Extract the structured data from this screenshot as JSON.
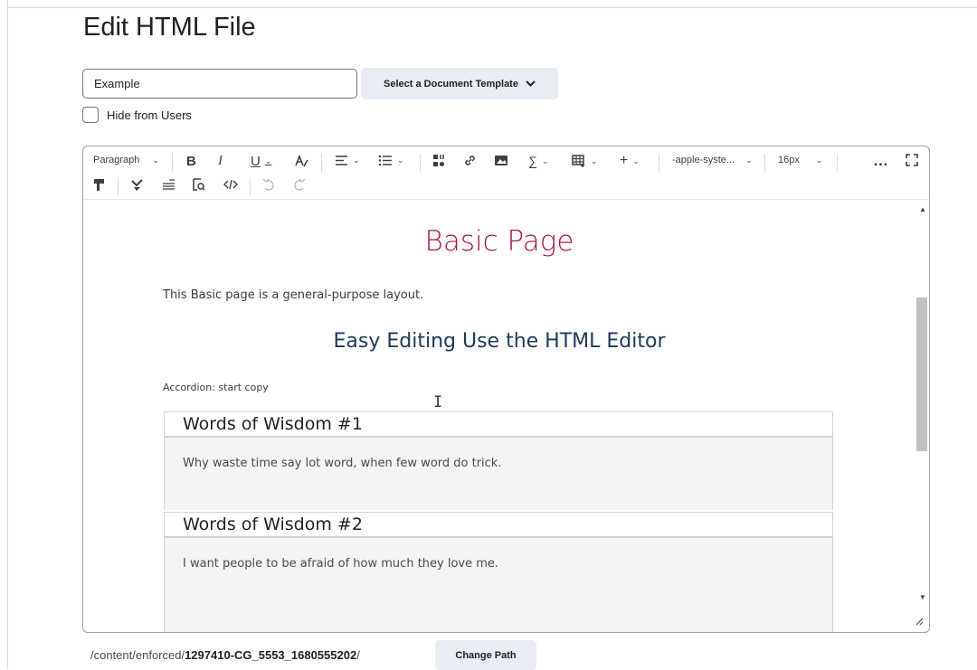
{
  "page": {
    "title": "Edit HTML File"
  },
  "form": {
    "title_value": "Example",
    "template_button_label": "Select a Document Template",
    "hide_from_users_label": "Hide from Users",
    "hide_from_users_checked": false
  },
  "toolbar": {
    "block_format": "Paragraph",
    "bold": "B",
    "italic": "I",
    "underline": "U",
    "insert_plus": "+",
    "font_family": "-apple-syste...",
    "font_size": "16px",
    "more": "…"
  },
  "document": {
    "heading": "Basic Page",
    "intro": "This Basic page is a general-purpose layout.",
    "subheading": "Easy Editing Use the HTML Editor",
    "accordion_note": "Accordion: start copy",
    "accordion": [
      {
        "title": "Words of Wisdom #1",
        "body": "Why waste time say lot word, when few word do trick."
      },
      {
        "title": "Words of Wisdom #2",
        "body": "I want people to be afraid of how much they love me."
      }
    ]
  },
  "footer": {
    "path_prefix": "/content/enforced/",
    "path_folder": "1297410-CG_5553_1680555202",
    "path_suffix": "/",
    "change_path_label": "Change Path"
  },
  "colors": {
    "heading": "#a6193b",
    "subheading": "#1e3a5c",
    "button_bg": "#e8edf4",
    "accordion_body_bg": "#f4f4f4"
  }
}
